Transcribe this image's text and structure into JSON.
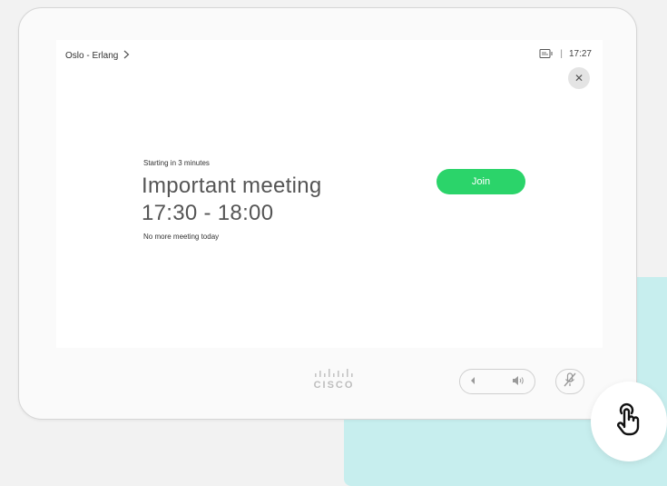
{
  "header": {
    "location": "Oslo - Erlang",
    "time": "17:27"
  },
  "meeting": {
    "starting_text": "Starting in 3 minutes",
    "title": "Important meeting",
    "time_range": "17:30 - 18:00",
    "footer_text": "No more meeting today"
  },
  "actions": {
    "join_label": "Join",
    "close_glyph": "✕"
  },
  "device": {
    "brand": "CISCO"
  },
  "colors": {
    "join_green": "#2bd46a",
    "teal_panel": "#c7eeee",
    "background": "#f2f2f2"
  },
  "icons": {
    "camera": "camera-display-icon",
    "chevron": "chevron-right-icon",
    "close": "close-icon",
    "volume_down": "volume-down-icon",
    "volume_up": "volume-up-icon",
    "mute": "microphone-mute-icon",
    "touch": "touch-hand-icon"
  }
}
